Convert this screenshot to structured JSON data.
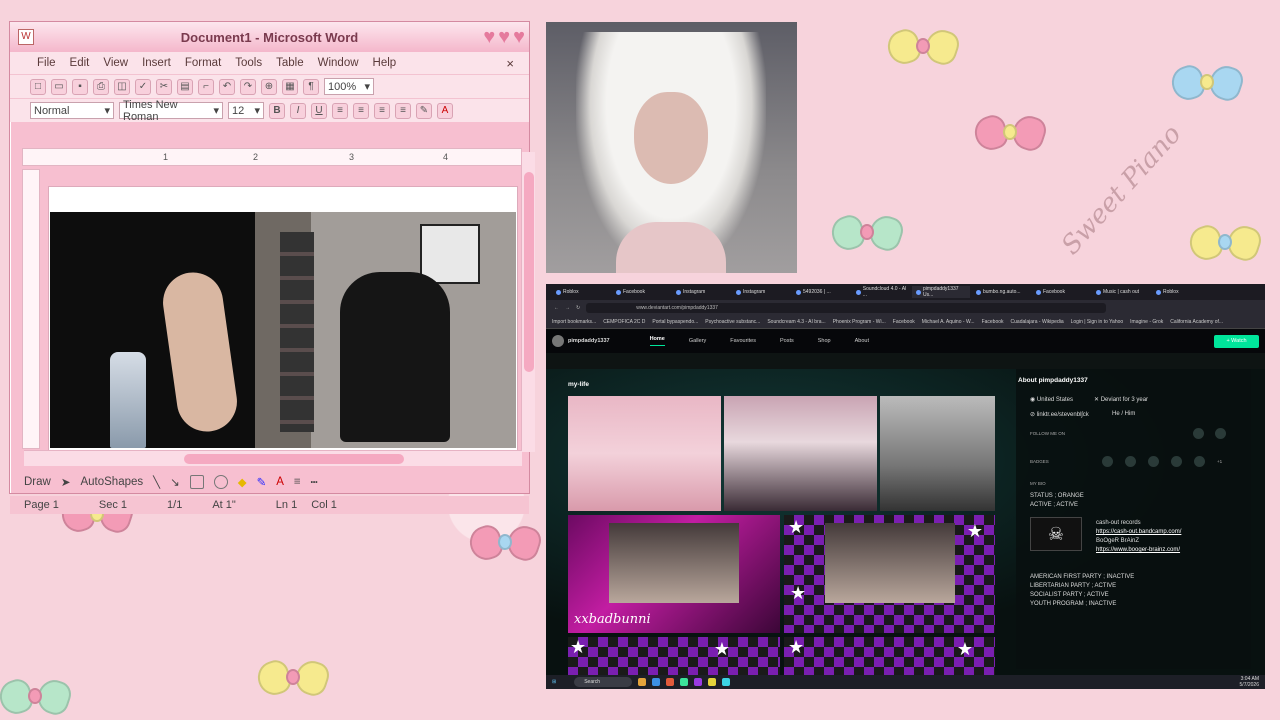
{
  "wallpaper": {
    "script_text": "Sweet Piano",
    "colors": {
      "background": "#f7d3dc",
      "bow_yellow": "#f6ea8e",
      "bow_pink": "#f39bb6",
      "bow_blue": "#a9d7f1",
      "bow_green": "#b7e6c9"
    }
  },
  "word": {
    "title": "Document1 - Microsoft Word",
    "menu": [
      "File",
      "Edit",
      "View",
      "Insert",
      "Format",
      "Tools",
      "Table",
      "Window",
      "Help"
    ],
    "close_glyph": "×",
    "zoom": "100%",
    "style": "Normal",
    "font": "Times New Roman",
    "size": "12",
    "ruler_marks": [
      "1",
      "2",
      "3",
      "4"
    ],
    "draw_label": "Draw",
    "autoshapes_label": "AutoShapes",
    "status": {
      "page": "Page 1",
      "sec": "Sec 1",
      "pages": "1/1",
      "at": "At 1\"",
      "ln": "Ln 1",
      "col": "Col 1"
    }
  },
  "browser": {
    "tabs": [
      "Roblox",
      "Facebook",
      "Instagram",
      "Instagram",
      "5492036 | ...",
      "Soundcloud 4.0 - AI ...",
      "pimpdaddy1337 Us...",
      "bumbo.ng.auto...",
      "Facebook",
      "Music | cash out",
      "Roblox"
    ],
    "url": "www.deviantart.com/pimpdaddy1337",
    "bookmarks": [
      "Import bookmarks...",
      "CEMPOFICA 2C D",
      "Portal bypaspendo...",
      "Psychoactive substanc...",
      "Soundcream 4.3 - AI bra...",
      "Phoenix Program - Wi...",
      "Facebook",
      "Michael A. Aquino - W...",
      "Facebook",
      "Cuadalajara - Wikipedia",
      "Login | Sign in to Yahoo",
      "Imagine - Grok",
      "California Academy of..."
    ],
    "da": {
      "username": "pimpdaddy1337",
      "nav": [
        "Home",
        "Gallery",
        "Favourites",
        "Posts",
        "Shop",
        "About"
      ],
      "watch_label": "+ Watch",
      "gallery_title": "my-life",
      "caption": "xxbadbunni",
      "about": {
        "title": "About pimpdaddy1337",
        "country": "United States",
        "deviant_for": "Deviant for 3 year",
        "link": "linktr.ee/stevenblʃck",
        "pronouns": "He / Him",
        "follow_label": "FOLLOW ME ON",
        "badges_label": "BADGES",
        "badge_more": "+1",
        "bio_label": "MY BIO",
        "status_lines": [
          "STATUS ; ORANGE",
          "ACTIVE ; ACTIVE"
        ],
        "records_label": "cash-out records",
        "link1": "https://cash-out.bandcamp.com/",
        "band": "BoOgeR BrAinZ",
        "link2": "https://www.booger-brainz.com/",
        "parties": [
          "AMERICAN FIRST PARTY ; INACTIVE",
          "LIBERTARIAN PARTY ; ACTIVE",
          "SOCIALIST PARTY ; ACTIVE",
          "YOUTH PROGRAM ; INACTIVE"
        ]
      }
    },
    "taskbar": {
      "search_label": "Search",
      "time": "3:04 AM",
      "date": "5/7/2026"
    }
  }
}
